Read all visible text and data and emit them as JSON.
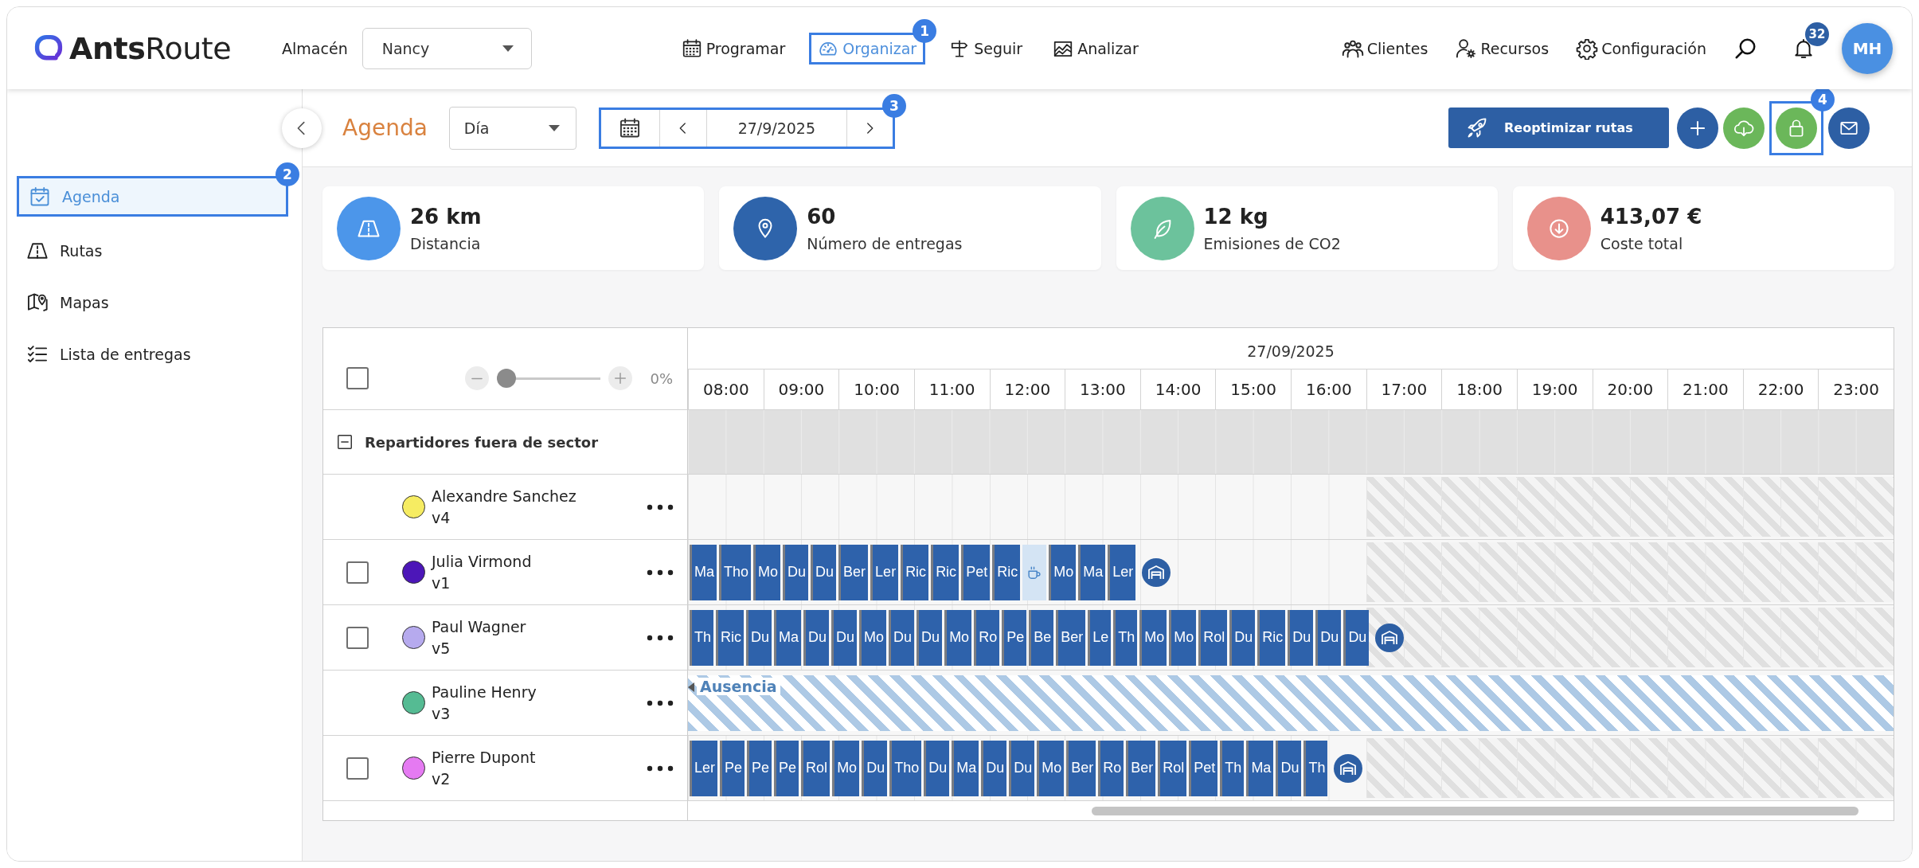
{
  "header": {
    "logo": "**Ants**Route",
    "warehouse": {
      "label": "Almacén",
      "value": "Nancy"
    },
    "nav": [
      {
        "kind": "schedule",
        "label": "Programar",
        "selected": false
      },
      {
        "kind": "organize",
        "label": "Organizar",
        "selected": true,
        "callout": "1"
      },
      {
        "kind": "track",
        "label": "Seguir",
        "selected": false
      },
      {
        "kind": "analyze",
        "label": "Analizar",
        "selected": false
      }
    ],
    "tools": [
      {
        "kind": "clients",
        "label": "Clientes"
      },
      {
        "kind": "resources",
        "label": "Recursos"
      },
      {
        "kind": "settings",
        "label": "Configuración"
      }
    ],
    "notifications": {
      "count": "32"
    },
    "avatar": {
      "initials": "MH"
    }
  },
  "sidebar": {
    "items": [
      {
        "kind": "agenda",
        "label": "Agenda",
        "selected": true,
        "callout": "2"
      },
      {
        "kind": "routes",
        "label": "Rutas",
        "selected": false
      },
      {
        "kind": "maps",
        "label": "Mapas",
        "selected": false
      },
      {
        "kind": "deliveries",
        "label": "Lista de entregas",
        "selected": false
      }
    ]
  },
  "toolbar": {
    "title": "Agenda",
    "view": {
      "value": "Día"
    },
    "date_nav": {
      "date": "27/9/2025",
      "callout": "3"
    },
    "primary_button": {
      "label": "Reoptimizar rutas"
    },
    "actions": [
      {
        "kind": "add"
      },
      {
        "kind": "download"
      },
      {
        "kind": "lock",
        "callout": "4"
      },
      {
        "kind": "mail"
      }
    ]
  },
  "stats": [
    {
      "kind": "distance",
      "value": "26 km",
      "label": "Distancia"
    },
    {
      "kind": "deliveries",
      "value": "60",
      "label": "Número de entregas"
    },
    {
      "kind": "emissions",
      "value": "12 kg",
      "label": "Emisiones de CO2"
    },
    {
      "kind": "cost",
      "value": "413,07 €",
      "label": "Coste total"
    }
  ],
  "schedule": {
    "select_all": {
      "checked": false
    },
    "zoom": {
      "level": 0,
      "reading": "0%"
    },
    "date": "27/09/2025",
    "hours": [
      {
        "label": "08:00",
        "working": true
      },
      {
        "label": "09:00",
        "working": true
      },
      {
        "label": "10:00",
        "working": true
      },
      {
        "label": "11:00",
        "working": true
      },
      {
        "label": "12:00",
        "working": true
      },
      {
        "label": "13:00",
        "working": true
      },
      {
        "label": "14:00",
        "working": true
      },
      {
        "label": "15:00",
        "working": true
      },
      {
        "label": "16:00",
        "working": true
      },
      {
        "label": "17:00",
        "working": false
      },
      {
        "label": "18:00",
        "working": false
      },
      {
        "label": "19:00",
        "working": false
      },
      {
        "label": "20:00",
        "working": false
      },
      {
        "label": "21:00",
        "working": false
      },
      {
        "label": "22:00",
        "working": false
      },
      {
        "label": "23:00",
        "working": false
      }
    ],
    "group": {
      "label": "Repartidores fuera de sector",
      "expanded": true
    },
    "drivers": [
      {
        "name": "Alexandre Sanchez",
        "vehicle": "v4",
        "color": "#f6ec62"
      },
      {
        "name": "Julia Virmond",
        "vehicle": "v1",
        "color": "#4c16b8",
        "checkbox": {
          "checked": false
        },
        "stops": [
          {
            "kind": "stop",
            "label": "Ma"
          },
          {
            "kind": "stop",
            "label": "Tho"
          },
          {
            "kind": "stop",
            "label": "Mo"
          },
          {
            "kind": "stop",
            "label": "Du"
          },
          {
            "kind": "stop",
            "label": "Du"
          },
          {
            "kind": "stop",
            "label": "Ber"
          },
          {
            "kind": "stop",
            "label": "Ler"
          },
          {
            "kind": "stop",
            "label": "Ric"
          },
          {
            "kind": "stop",
            "label": "Ric"
          },
          {
            "kind": "stop",
            "label": "Pet"
          },
          {
            "kind": "stop",
            "label": "Ric"
          },
          {
            "kind": "break"
          },
          {
            "kind": "stop",
            "label": "Mo"
          },
          {
            "kind": "stop",
            "label": "Ma"
          },
          {
            "kind": "stop",
            "label": "Ler"
          },
          {
            "kind": "depot"
          }
        ]
      },
      {
        "name": "Paul Wagner",
        "vehicle": "v5",
        "color": "#b6aaee",
        "checkbox": {
          "checked": false
        },
        "stops": [
          {
            "kind": "stop",
            "label": "Th"
          },
          {
            "kind": "stop",
            "label": "Ric"
          },
          {
            "kind": "stop",
            "label": "Du"
          },
          {
            "kind": "stop",
            "label": "Ma"
          },
          {
            "kind": "stop",
            "label": "Du"
          },
          {
            "kind": "stop",
            "label": "Du"
          },
          {
            "kind": "stop",
            "label": "Mo"
          },
          {
            "kind": "stop",
            "label": "Du"
          },
          {
            "kind": "stop",
            "label": "Du"
          },
          {
            "kind": "stop",
            "label": "Mo"
          },
          {
            "kind": "stop",
            "label": "Ro"
          },
          {
            "kind": "stop",
            "label": "Pe"
          },
          {
            "kind": "stop",
            "label": "Be"
          },
          {
            "kind": "stop",
            "label": "Ber"
          },
          {
            "kind": "stop",
            "label": "Le"
          },
          {
            "kind": "stop",
            "label": "Th"
          },
          {
            "kind": "stop",
            "label": "Mo"
          },
          {
            "kind": "stop",
            "label": "Mo"
          },
          {
            "kind": "stop",
            "label": "Rol"
          },
          {
            "kind": "stop",
            "label": "Du"
          },
          {
            "kind": "stop",
            "label": "Ric"
          },
          {
            "kind": "stop",
            "label": "Du"
          },
          {
            "kind": "stop",
            "label": "Du"
          },
          {
            "kind": "stop",
            "label": "Du"
          },
          {
            "kind": "depot"
          }
        ]
      },
      {
        "name": "Pauline Henry",
        "vehicle": "v3",
        "color": "#55bb93",
        "absence": "Ausencia"
      },
      {
        "name": "Pierre Dupont",
        "vehicle": "v2",
        "color": "#e57af2",
        "checkbox": {
          "checked": false
        },
        "stops": [
          {
            "kind": "stop",
            "label": "Ler"
          },
          {
            "kind": "stop",
            "label": "Pe"
          },
          {
            "kind": "stop",
            "label": "Pe"
          },
          {
            "kind": "stop",
            "label": "Pe"
          },
          {
            "kind": "stop",
            "label": "Rol"
          },
          {
            "kind": "stop",
            "label": "Mo"
          },
          {
            "kind": "stop",
            "label": "Du"
          },
          {
            "kind": "stop",
            "label": "Tho"
          },
          {
            "kind": "stop",
            "label": "Du"
          },
          {
            "kind": "stop",
            "label": "Ma"
          },
          {
            "kind": "stop",
            "label": "Du"
          },
          {
            "kind": "stop",
            "label": "Du"
          },
          {
            "kind": "stop",
            "label": "Mo"
          },
          {
            "kind": "stop",
            "label": "Ber"
          },
          {
            "kind": "stop",
            "label": "Ro"
          },
          {
            "kind": "stop",
            "label": "Ber"
          },
          {
            "kind": "stop",
            "label": "Rol"
          },
          {
            "kind": "stop",
            "label": "Pet"
          },
          {
            "kind": "stop",
            "label": "Th"
          },
          {
            "kind": "stop",
            "label": "Ma"
          },
          {
            "kind": "stop",
            "label": "Du"
          },
          {
            "kind": "stop",
            "label": "Th"
          },
          {
            "kind": "depot"
          }
        ]
      }
    ]
  }
}
